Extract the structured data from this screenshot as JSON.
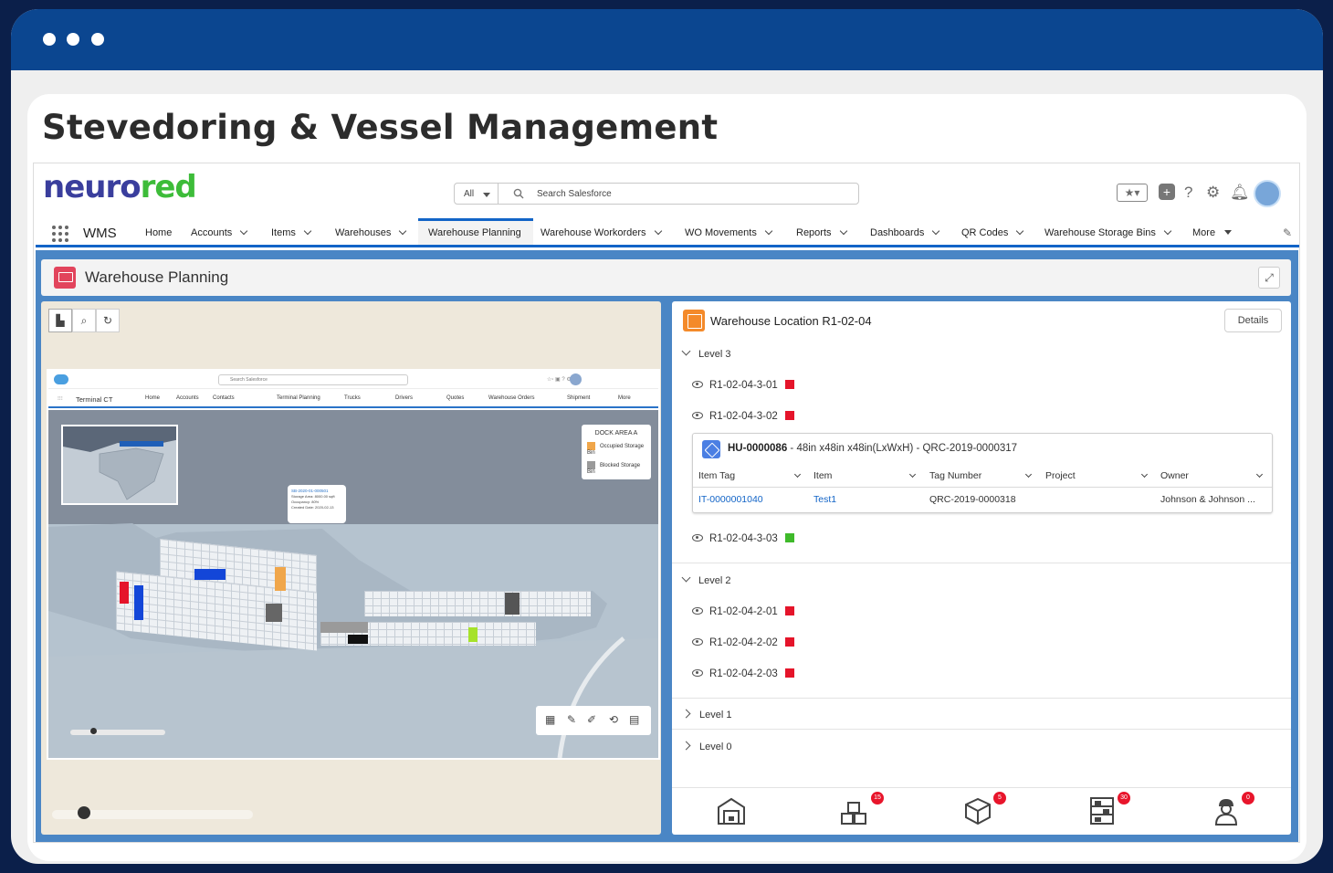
{
  "page": {
    "heading": "Stevedoring & Vessel Management"
  },
  "logo": {
    "part1": "neuro",
    "part2": "red"
  },
  "search": {
    "scope": "All",
    "placeholder": "Search Salesforce"
  },
  "nav": {
    "app_name": "WMS",
    "items": [
      "Home",
      "Accounts",
      "Items",
      "Warehouses",
      "Warehouse Planning",
      "Warehouse Workorders",
      "WO Movements",
      "Reports",
      "Dashboards",
      "QR Codes",
      "Warehouse Storage Bins",
      "More"
    ],
    "active": "Warehouse Planning"
  },
  "planning": {
    "title": "Warehouse Planning"
  },
  "mini_app": {
    "search_placeholder": "Search Salesforce",
    "app_name": "Terminal CT",
    "nav": [
      "Home",
      "Accounts",
      "Contacts",
      "Terminal Planning",
      "Trucks",
      "Drivers",
      "Quotes",
      "Warehouse Orders",
      "Shipment",
      "More"
    ],
    "legend_title": "DOCK AREA A",
    "legend_items": [
      "Occupied Storage Bin",
      "Blocked Storage Bin"
    ],
    "popup_title": "SB-2020-01-000501",
    "popup_lines": [
      "Storage Area: 8000.00 sqft",
      "Occupancy: 80%",
      "Created Date: 2020-02-13"
    ]
  },
  "location": {
    "title": "Warehouse Location R1-02-04",
    "details_label": "Details",
    "levels": {
      "l3": "Level 3",
      "l2": "Level 2",
      "l1": "Level 1",
      "l0": "Level 0"
    },
    "bins": {
      "b3_01": "R1-02-04-3-01",
      "b3_02": "R1-02-04-3-02",
      "b3_03": "R1-02-04-3-03",
      "b2_01": "R1-02-04-2-01",
      "b2_02": "R1-02-04-2-02",
      "b2_03": "R1-02-04-2-03"
    },
    "status_colors": {
      "occupied": "#e5142a",
      "available": "#3fba2a"
    }
  },
  "handling_unit": {
    "id": "HU-0000086",
    "desc": " - 48in x48in x48in(LxWxH) - QRC-2019-0000317",
    "columns": [
      "Item Tag",
      "Item",
      "Tag Number",
      "Project",
      "Owner"
    ],
    "row": [
      "IT-0000001040",
      "Test1",
      "QRC-2019-0000318",
      "",
      "Johnson & Johnson ..."
    ]
  },
  "bottom_badges": {
    "b2": "15",
    "b3": "5",
    "b4": "30",
    "b5": "0"
  }
}
